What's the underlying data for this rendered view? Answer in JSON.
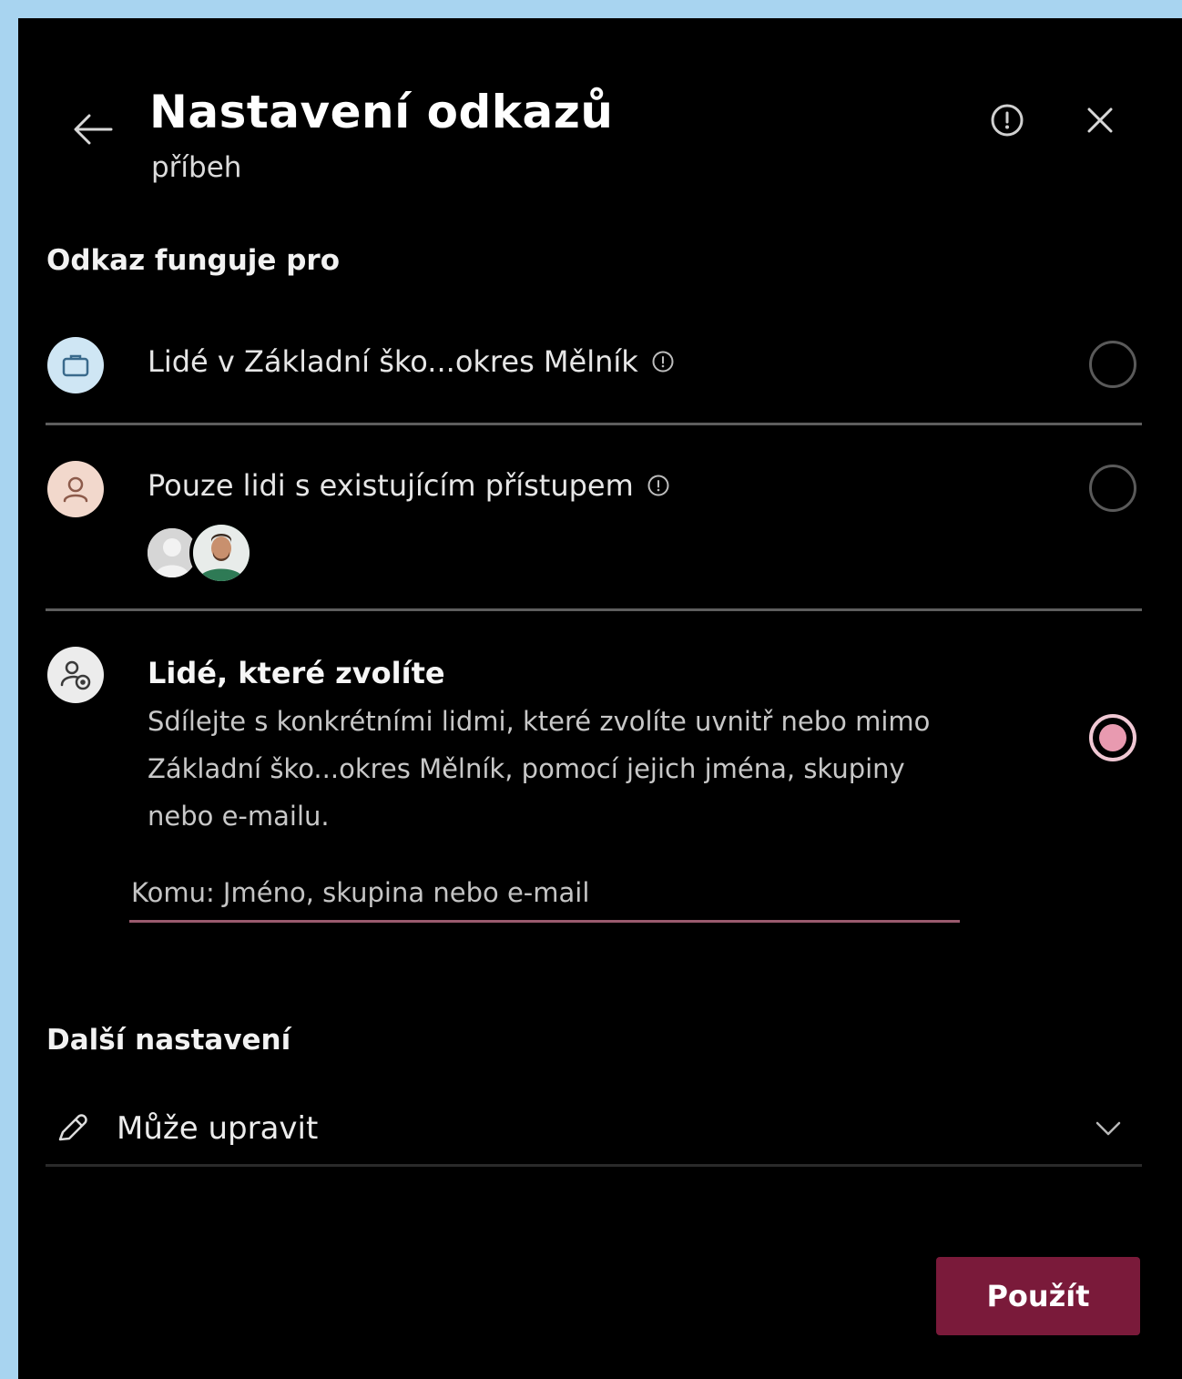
{
  "header": {
    "title": "Nastavení odkazů",
    "subtitle": "příbeh"
  },
  "link_works_for": {
    "heading": "Odkaz funguje pro",
    "options": [
      {
        "label": "Lidé v Základní ško...okres Mělník",
        "selected": false,
        "icon": "briefcase-icon"
      },
      {
        "label": "Pouze lidi s existujícím přístupem",
        "selected": false,
        "icon": "person-icon"
      },
      {
        "label": "Lidé, které zvolíte",
        "description": "Sdílejte s konkrétními lidmi, které zvolíte uvnitř nebo mimo Základní ško...okres Mělník, pomocí jejich jména, skupiny nebo e-mailu.",
        "selected": true,
        "icon": "people-icon"
      }
    ],
    "to_field": {
      "value": "",
      "placeholder": "Komu: Jméno, skupina nebo e-mail"
    }
  },
  "other_settings": {
    "heading": "Další nastavení",
    "permission": {
      "value": "Může upravit",
      "icon": "pencil-icon"
    }
  },
  "footer": {
    "apply_label": "Použít"
  },
  "colors": {
    "panel_bg": "#000000",
    "accent": "#7a1a3a",
    "radio_selected": "#e89ab0",
    "frame_bg": "#a8d4f0"
  }
}
